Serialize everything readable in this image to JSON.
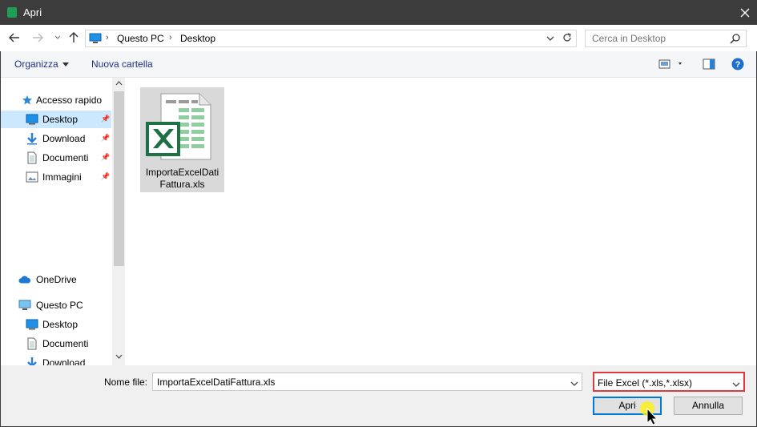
{
  "window": {
    "title": "Apri",
    "close_icon": "close-icon"
  },
  "address_bar": {
    "crumbs": [
      "Questo PC",
      "Desktop"
    ],
    "search_placeholder": "Cerca in Desktop"
  },
  "toolbar": {
    "organize_label": "Organizza",
    "new_folder_label": "Nuova cartella"
  },
  "sidebar": {
    "quick_access": "Accesso rapido",
    "quick_items": [
      {
        "label": "Desktop",
        "icon": "desktop-icon",
        "selected": true
      },
      {
        "label": "Download",
        "icon": "download-icon"
      },
      {
        "label": "Documenti",
        "icon": "documents-icon"
      },
      {
        "label": "Immagini",
        "icon": "pictures-icon"
      }
    ],
    "onedrive": "OneDrive",
    "this_pc": "Questo PC",
    "pc_items": [
      {
        "label": "Desktop",
        "icon": "desktop-icon"
      },
      {
        "label": "Documenti",
        "icon": "documents-icon"
      },
      {
        "label": "Download",
        "icon": "download-icon"
      }
    ]
  },
  "files": [
    {
      "name_line1": "ImportaExcelDati",
      "name_line2": "Fattura.xls",
      "icon": "excel-file-icon",
      "selected": true
    }
  ],
  "bottom": {
    "filename_label": "Nome file:",
    "filename_value": "ImportaExcelDatiFattura.xls",
    "filter_value": "File Excel (*.xls,*.xlsx)",
    "open_label": "Apri",
    "cancel_label": "Annulla"
  },
  "colors": {
    "titlebar": "#3c3c3c",
    "selection": "#cce8ff",
    "excel_green": "#1e7145",
    "highlight_border": "#e0393e",
    "primary_border": "#0078d7"
  }
}
